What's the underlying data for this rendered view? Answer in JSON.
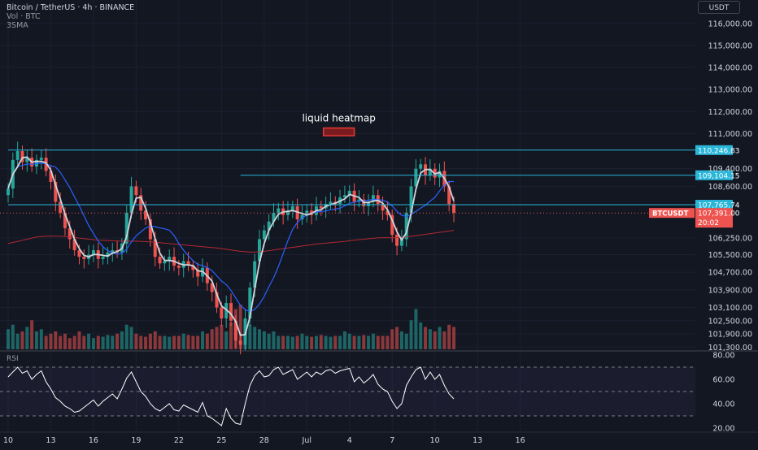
{
  "header": {
    "symbol_line": "Bitcoin / TetherUS · 4h · BINANCE",
    "volume_line": "Vol · BTC",
    "study_line": "3SMA"
  },
  "currency_button": "USDT",
  "annotation": {
    "label": "liquid heatmap",
    "zone_low": 110900,
    "zone_high": 111250,
    "zone_x0": 66.5,
    "zone_x1": 73,
    "color": "#e53935"
  },
  "colors": {
    "background": "#131722",
    "up": "#26a69a",
    "down": "#ef5350",
    "sma_fast": "#d1d4dc",
    "sma_mid": "#2962ff",
    "sma_slow": "#b22833",
    "level": "#29b6d9",
    "rsi": "#ffffff",
    "rsi_band": "#7e57c2"
  },
  "chart_data": [
    {
      "type": "candlestick",
      "title": "Bitcoin / TetherUS · 4h · BINANCE",
      "x_ticks": [
        {
          "i": 0,
          "label": "10"
        },
        {
          "i": 9,
          "label": "13"
        },
        {
          "i": 18,
          "label": "16"
        },
        {
          "i": 27,
          "label": "19"
        },
        {
          "i": 36,
          "label": "22"
        },
        {
          "i": 45,
          "label": "25"
        },
        {
          "i": 54,
          "label": "28"
        },
        {
          "i": 63,
          "label": "Jul"
        },
        {
          "i": 72,
          "label": "4"
        },
        {
          "i": 81,
          "label": "7"
        },
        {
          "i": 90,
          "label": "10"
        },
        {
          "i": 99,
          "label": "13"
        },
        {
          "i": 108,
          "label": "16"
        }
      ],
      "y_ticks": [
        116000,
        115000,
        114000,
        113000,
        112000,
        111000,
        109400,
        108600,
        106250,
        105500,
        104700,
        103900,
        103100,
        102500,
        101900,
        101300
      ],
      "y_tick_labels": [
        "116,000.00",
        "115,000.00",
        "114,000.00",
        "113,000.00",
        "112,000.00",
        "111,000.00",
        "109,400.00",
        "108,600.00",
        "106,250.00",
        "105,500.00",
        "104,700.00",
        "103,900.00",
        "103,100.00",
        "102,500.00",
        "101,900.00",
        "101,300.00"
      ],
      "ylim": [
        101200,
        116400
      ],
      "levels": [
        {
          "price": 110246.83,
          "label": "110,246.83",
          "i_start": 0
        },
        {
          "price": 109104.15,
          "label": "109,104.15",
          "i_start": 49
        },
        {
          "price": 107765.74,
          "label": "107,765.74",
          "i_start": 0
        }
      ],
      "last_price": {
        "symbol": "BTCUSDT",
        "price_label": "107,391.00",
        "countdown": "20:02",
        "price": 107391
      },
      "closes": [
        108500,
        109800,
        110200,
        109700,
        109900,
        109500,
        109800,
        109900,
        109300,
        108800,
        107900,
        107400,
        106700,
        106200,
        105700,
        105400,
        105300,
        105500,
        105700,
        105300,
        105400,
        105600,
        105700,
        105600,
        106000,
        107400,
        108600,
        108200,
        107500,
        107100,
        106200,
        105400,
        105100,
        105200,
        105400,
        105000,
        104900,
        105200,
        105000,
        104800,
        104500,
        104900,
        104200,
        103800,
        103100,
        102600,
        103300,
        102500,
        101600,
        101400,
        102600,
        104000,
        105200,
        106200,
        106600,
        107000,
        107400,
        107600,
        107300,
        107500,
        107700,
        107100,
        107300,
        107500,
        107300,
        107700,
        107600,
        107800,
        107900,
        107800,
        108100,
        108200,
        108400,
        107900,
        108000,
        107700,
        107900,
        108200,
        107800,
        107500,
        107300,
        106400,
        105900,
        106200,
        107400,
        108600,
        109400,
        109600,
        109100,
        109400,
        109000,
        109300,
        108600,
        107800,
        107400
      ],
      "volumes": [
        0.45,
        0.55,
        0.35,
        0.4,
        0.5,
        0.65,
        0.4,
        0.45,
        0.3,
        0.35,
        0.4,
        0.3,
        0.35,
        0.25,
        0.3,
        0.4,
        0.3,
        0.35,
        0.25,
        0.3,
        0.28,
        0.32,
        0.3,
        0.35,
        0.4,
        0.55,
        0.5,
        0.35,
        0.3,
        0.28,
        0.35,
        0.4,
        0.3,
        0.3,
        0.28,
        0.3,
        0.3,
        0.35,
        0.32,
        0.3,
        0.3,
        0.4,
        0.35,
        0.45,
        0.5,
        0.55,
        0.4,
        0.6,
        0.9,
        1.0,
        0.65,
        0.55,
        0.5,
        0.45,
        0.4,
        0.35,
        0.4,
        0.3,
        0.3,
        0.3,
        0.28,
        0.3,
        0.35,
        0.3,
        0.28,
        0.3,
        0.32,
        0.3,
        0.28,
        0.3,
        0.3,
        0.4,
        0.35,
        0.3,
        0.3,
        0.32,
        0.3,
        0.35,
        0.3,
        0.3,
        0.3,
        0.45,
        0.5,
        0.4,
        0.35,
        0.65,
        0.9,
        0.6,
        0.5,
        0.45,
        0.4,
        0.5,
        0.4,
        0.55,
        0.5
      ],
      "sma_slow": [
        106000,
        106050,
        106100,
        106150,
        106200,
        106250,
        106300,
        106320,
        106330,
        106340,
        106340,
        106330,
        106320,
        106300,
        106280,
        106250,
        106230,
        106200,
        106180,
        106160,
        106150,
        106140,
        106130,
        106120,
        106110,
        106110,
        106110,
        106110,
        106100,
        106090,
        106080,
        106060,
        106040,
        106020,
        106000,
        105980,
        105960,
        105940,
        105920,
        105900,
        105880,
        105860,
        105840,
        105820,
        105800,
        105770,
        105740,
        105710,
        105680,
        105650,
        105630,
        105620,
        105620,
        105630,
        105650,
        105680,
        105710,
        105740,
        105770,
        105800,
        105830,
        105860,
        105890,
        105920,
        105950,
        105980,
        106000,
        106020,
        106040,
        106060,
        106080,
        106100,
        106130,
        106160,
        106180,
        106200,
        106220,
        106240,
        106260,
        106270,
        106270,
        106270,
        106270,
        106280,
        106300,
        106330,
        106360,
        106390,
        106420,
        106450,
        106480,
        106510,
        106540,
        106570,
        106600
      ]
    },
    {
      "type": "line",
      "title": "RSI",
      "y_ticks": [
        80,
        60,
        40,
        20
      ],
      "y_tick_labels": [
        "80.00",
        "60.00",
        "40.00",
        "20.00"
      ],
      "ylim": [
        18,
        82
      ],
      "band": [
        30,
        70
      ],
      "values": [
        62,
        66,
        70,
        65,
        67,
        60,
        64,
        67,
        58,
        52,
        45,
        42,
        38,
        36,
        33,
        34,
        37,
        40,
        43,
        38,
        42,
        45,
        48,
        44,
        52,
        61,
        66,
        58,
        50,
        46,
        40,
        36,
        34,
        37,
        40,
        35,
        34,
        39,
        37,
        35,
        33,
        41,
        30,
        28,
        25,
        22,
        36,
        28,
        24,
        23,
        40,
        55,
        63,
        67,
        62,
        63,
        68,
        70,
        64,
        66,
        68,
        60,
        63,
        66,
        62,
        66,
        64,
        67,
        68,
        65,
        67,
        68,
        69,
        58,
        62,
        57,
        60,
        64,
        56,
        52,
        50,
        42,
        36,
        40,
        55,
        62,
        68,
        70,
        60,
        66,
        60,
        64,
        55,
        48,
        44
      ]
    }
  ]
}
